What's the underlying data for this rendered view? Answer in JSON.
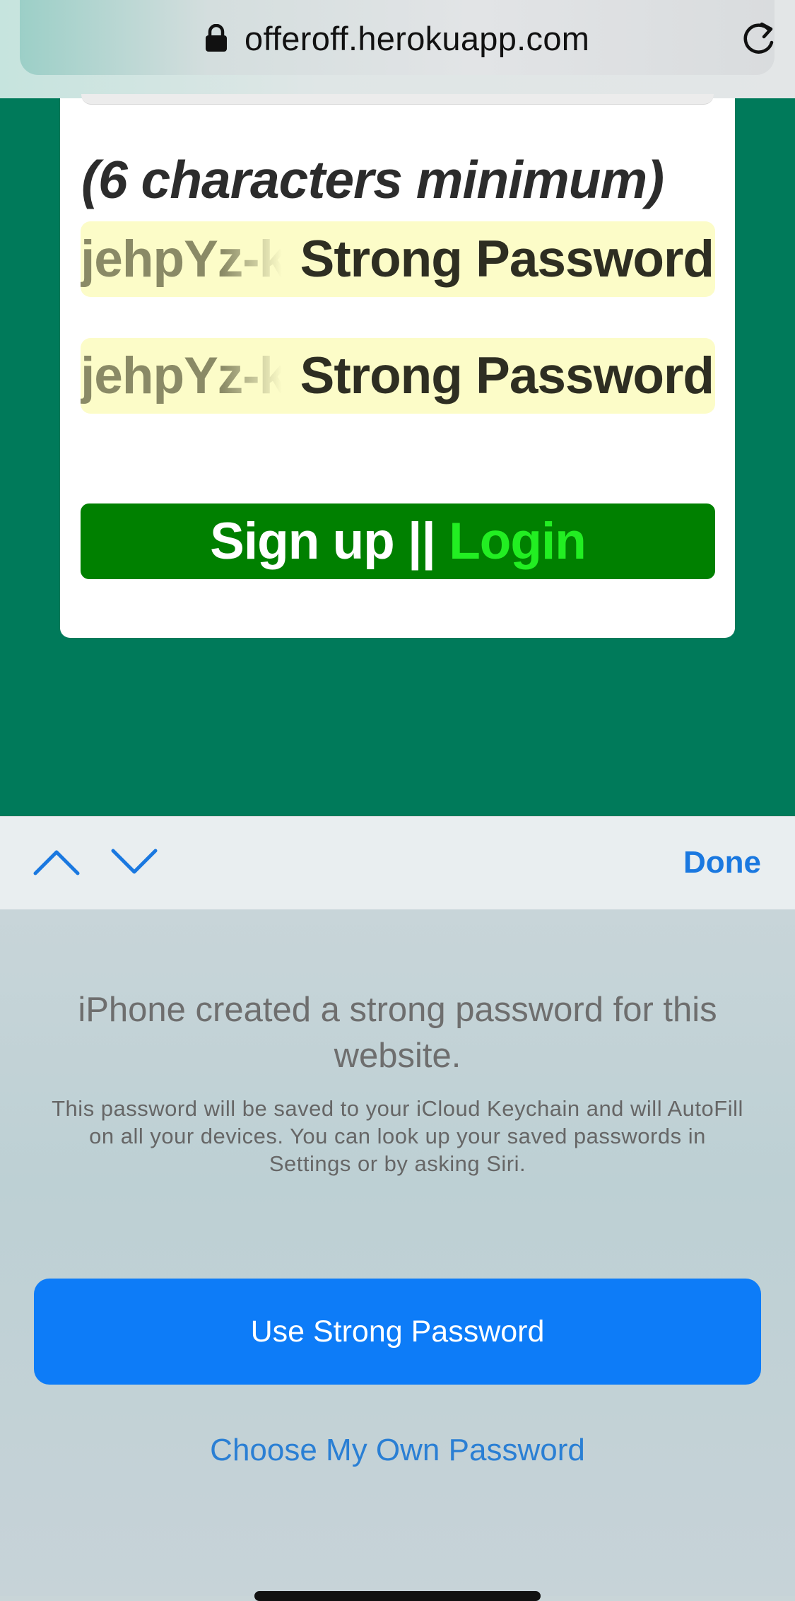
{
  "browser": {
    "url": "offeroff.herokuapp.com"
  },
  "form": {
    "password_hint": "(6 characters minimum)",
    "password_value": "jehpYz-k",
    "password_badge": "Strong Password",
    "confirm_value": "jehpYz-k",
    "confirm_badge": "Strong Password",
    "signup_label": "Sign up ||",
    "login_label": "Login"
  },
  "accessory_bar": {
    "done_label": "Done"
  },
  "sheet": {
    "title": "iPhone created a strong password for this website.",
    "description": "This password will be saved to your iCloud Keychain and will AutoFill on all your devices. You can look up your saved passwords in Settings or by asking Siri.",
    "use_strong_label": "Use Strong Password",
    "choose_own_label": "Choose My Own Password"
  },
  "colors": {
    "page_bg": "#007a5a",
    "signup_bg": "#008000",
    "login_text": "#22ee22",
    "autofill_bg": "#fcfcc8",
    "ios_blue": "#0d7cf8"
  }
}
